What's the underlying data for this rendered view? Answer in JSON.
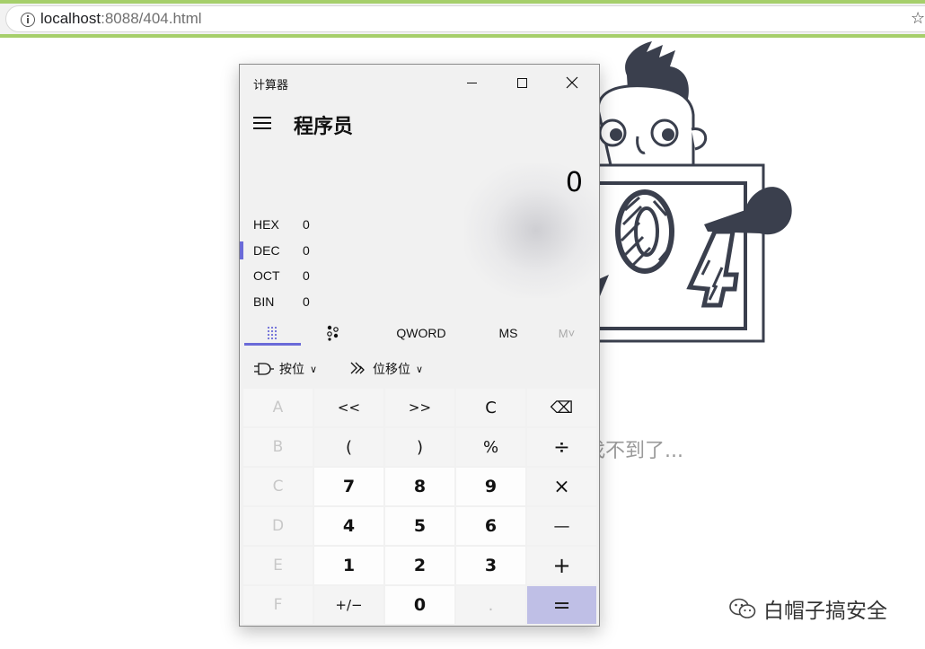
{
  "browser": {
    "url_host": "localhost",
    "url_rest": ":8088/404.html",
    "star_icon": "star-icon"
  },
  "page": {
    "notfound_text": "面找不到了...",
    "watermark": "白帽子搞安全"
  },
  "calculator": {
    "window_title": "计算器",
    "mode_title": "程序员",
    "display_value": "0",
    "bases": [
      {
        "label": "HEX",
        "value": "0"
      },
      {
        "label": "DEC",
        "value": "0"
      },
      {
        "label": "OCT",
        "value": "0"
      },
      {
        "label": "BIN",
        "value": "0"
      }
    ],
    "selected_base": "DEC",
    "tabs": {
      "word_size": "QWORD",
      "memory_store": "MS",
      "memory_list": "M˅"
    },
    "bit_ops": {
      "bitwise_label": "按位",
      "shift_label": "位移位"
    },
    "keys": [
      [
        "A",
        "<<",
        ">>",
        "C",
        "⌫"
      ],
      [
        "B",
        "(",
        ")",
        "%",
        "÷"
      ],
      [
        "C",
        "7",
        "8",
        "9",
        "×"
      ],
      [
        "D",
        "4",
        "5",
        "6",
        "—"
      ],
      [
        "E",
        "1",
        "2",
        "3",
        "+"
      ],
      [
        "F",
        "+/−",
        "0",
        ".",
        "="
      ]
    ]
  },
  "colors": {
    "accent": "#6a6ad8",
    "equals_bg": "#bfbfe6",
    "browser_border": "#a6cf6b"
  }
}
